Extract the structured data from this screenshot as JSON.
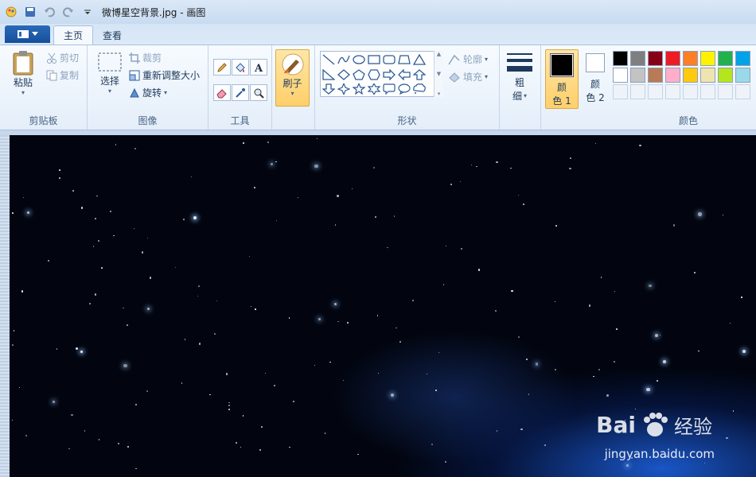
{
  "window": {
    "title": "微博星空背景.jpg - 画图"
  },
  "tabs": [
    {
      "label": "主页",
      "active": true
    },
    {
      "label": "查看",
      "active": false
    }
  ],
  "clipboard": {
    "paste": "粘贴",
    "cut": "剪切",
    "copy": "复制",
    "group_label": "剪贴板"
  },
  "image": {
    "select": "选择",
    "crop": "裁剪",
    "resize": "重新调整大小",
    "rotate": "旋转",
    "group_label": "图像"
  },
  "tools": {
    "group_label": "工具"
  },
  "brush": {
    "label": "刷子"
  },
  "shapes": {
    "outline": "轮廓",
    "fill": "填充",
    "group_label": "形状"
  },
  "size": {
    "label_top": "粗",
    "label_bottom": "细"
  },
  "colors": {
    "color1_top": "颜",
    "color1_bottom": "色 1",
    "color2_top": "颜",
    "color2_bottom": "色 2",
    "group_label": "颜色",
    "color1_value": "#000000",
    "color2_value": "#ffffff",
    "row1": [
      "#000000",
      "#7f7f7f",
      "#880015",
      "#ed1c24",
      "#ff7f27",
      "#fff200",
      "#22b14c",
      "#00a2e8"
    ],
    "row2": [
      "#ffffff",
      "#c3c3c3",
      "#b97a57",
      "#ffaec9",
      "#ffc90e",
      "#efe4b0",
      "#b5e61d",
      "#99d9ea"
    ]
  },
  "watermark": {
    "brand": "Bai",
    "brand_suffix": "经验",
    "url": "jingyan.baidu.com"
  }
}
